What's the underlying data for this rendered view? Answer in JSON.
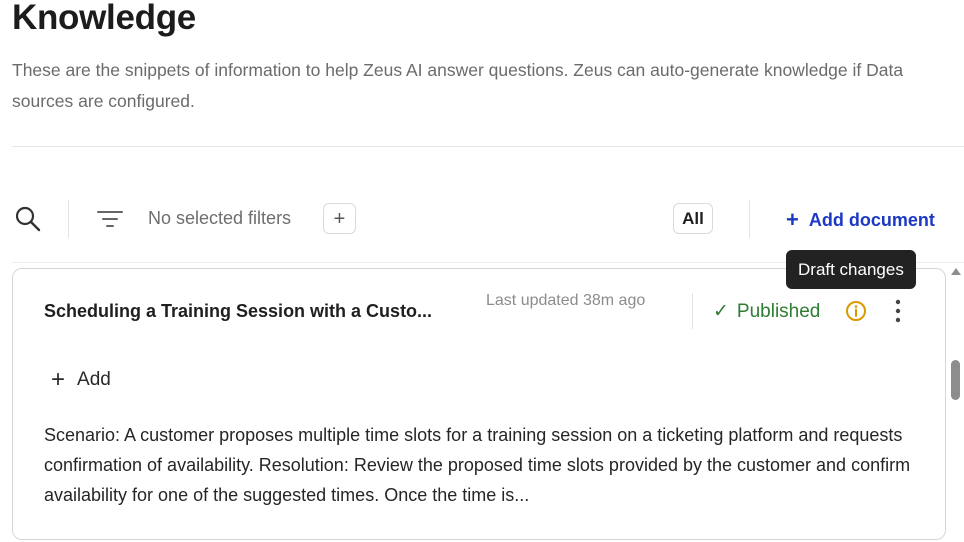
{
  "header": {
    "title": "Knowledge",
    "description": "These are the snippets of information to help Zeus AI answer questions. Zeus can auto-generate knowledge if Data sources are configured."
  },
  "toolbar": {
    "search_icon": "search-icon",
    "filter_icon": "filter-lines-icon",
    "filter_text": "No selected filters",
    "add_filter_label": "+",
    "view_toggle_label": "All",
    "add_document_plus": "+",
    "add_document_label": "Add document"
  },
  "tooltip": {
    "text": "Draft changes"
  },
  "documents": [
    {
      "title": "Scheduling a Training Session with a Custo...",
      "updated": "Last updated 38m ago",
      "status_check": "✓",
      "status": "Published",
      "status_color": "#2e7d32",
      "info_icon_color": "#d99a00",
      "add_plus": "+",
      "add_label": "Add",
      "body": "Scenario: A customer proposes multiple time slots for a training session on a ticketing platform and requests confirmation of availability. Resolution: Review the proposed time slots provided by the customer and confirm availability for one of the suggested times. Once the time is..."
    }
  ],
  "colors": {
    "accent": "#1d39c4",
    "tooltip_bg": "#222222"
  }
}
